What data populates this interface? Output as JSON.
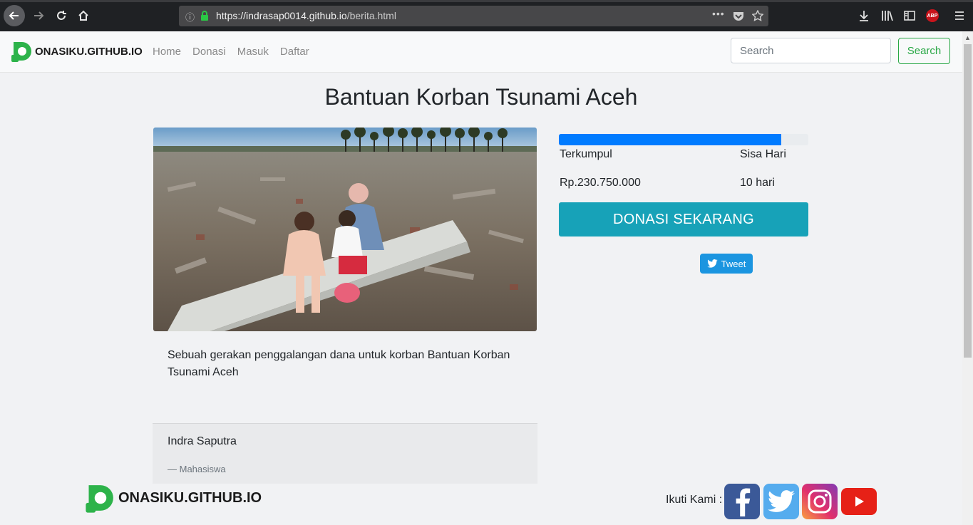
{
  "browser": {
    "url_host": "https://indrasap0014.github.io",
    "url_path": "/berita.html",
    "more_label": "•••",
    "abp_label": "ABP"
  },
  "navbar": {
    "brand": "ONASIKU.GITHUB.IO",
    "links": [
      "Home",
      "Donasi",
      "Masuk",
      "Daftar"
    ],
    "search_placeholder": "Search",
    "search_button": "Search"
  },
  "campaign": {
    "title": "Bantuan Korban Tsunami Aceh",
    "description": "Sebuah gerakan penggalangan dana untuk korban Bantuan Korban Tsunami Aceh",
    "progress_fraction": 0.89,
    "collected_label": "Terkumpul",
    "collected_value": "Rp.230.750.000",
    "days_label": "Sisa Hari",
    "days_value": "10 hari",
    "donate_button": "DONASI SEKARANG",
    "tweet_button": "Tweet",
    "author": "Indra Saputra",
    "author_role": "— Mahasiswa"
  },
  "footer": {
    "brand": "ONASIKU.GITHUB.IO",
    "follow_label": "Ikuti Kami :",
    "social_icons": [
      "facebook-icon",
      "twitter-icon",
      "instagram-icon",
      "youtube-icon"
    ]
  },
  "colors": {
    "primary": "#007bff",
    "info": "#17a2b8",
    "success": "#28a745",
    "brand_green": "#2db34a"
  }
}
